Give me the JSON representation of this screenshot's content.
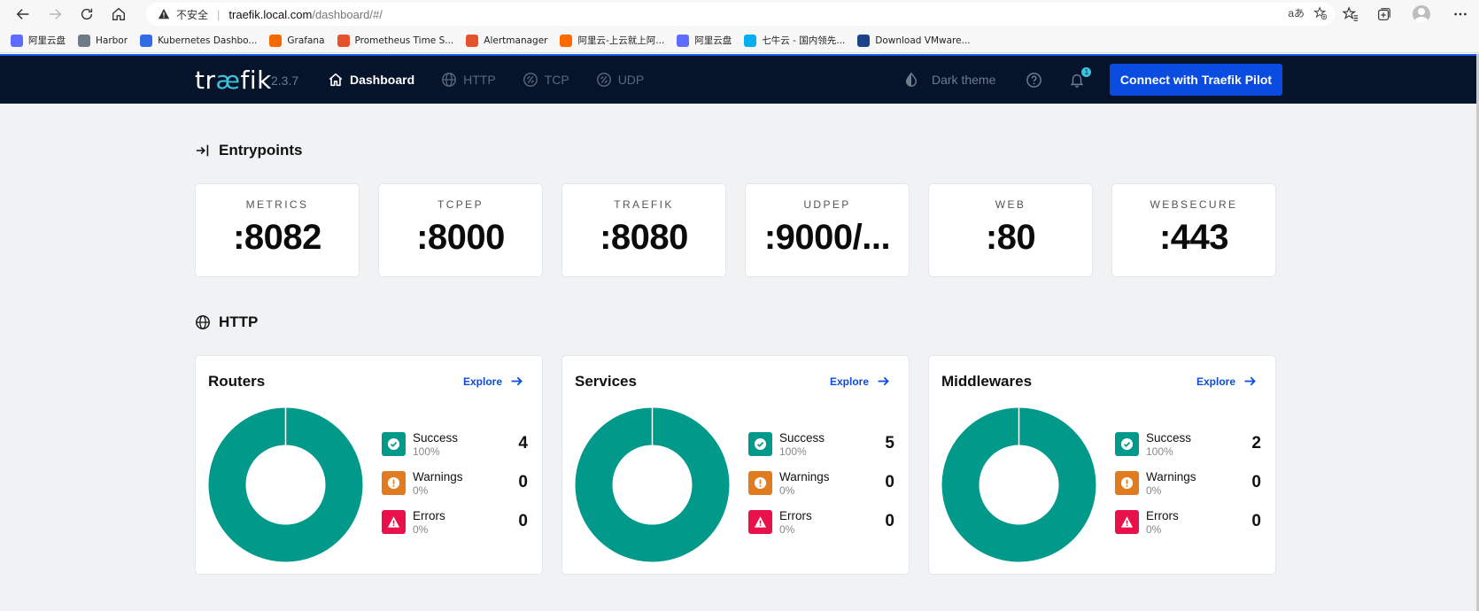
{
  "browser": {
    "insecure_label": "不安全",
    "url_host": "traefik.local.com",
    "url_path": "/dashboard/#/",
    "read_aloud": "aあ"
  },
  "bookmarks": [
    {
      "label": "阿里云盘",
      "icon": "aliyun-drive-icon",
      "color": "#5b6cff"
    },
    {
      "label": "Harbor",
      "icon": "harbor-icon",
      "color": "#6f7b86"
    },
    {
      "label": "Kubernetes Dashbo...",
      "icon": "kubernetes-icon",
      "color": "#326ce5"
    },
    {
      "label": "Grafana",
      "icon": "grafana-icon",
      "color": "#f46800"
    },
    {
      "label": "Prometheus Time S...",
      "icon": "prometheus-icon",
      "color": "#e6522c"
    },
    {
      "label": "Alertmanager",
      "icon": "alertmanager-icon",
      "color": "#e6522c"
    },
    {
      "label": "阿里云-上云就上阿...",
      "icon": "aliyun-icon",
      "color": "#ff6a00"
    },
    {
      "label": "阿里云盘",
      "icon": "aliyun-drive-icon",
      "color": "#5b6cff"
    },
    {
      "label": "七牛云 - 国内领先...",
      "icon": "qiniu-icon",
      "color": "#06aeef"
    },
    {
      "label": "Download VMware...",
      "icon": "vmware-icon",
      "color": "#1d428a"
    }
  ],
  "header": {
    "logo_pre": "tr",
    "logo_ae": "æ",
    "logo_post": "fik",
    "version": "2.3.7",
    "nav": [
      {
        "label": "Dashboard",
        "icon": "home-icon",
        "active": true
      },
      {
        "label": "HTTP",
        "icon": "globe-icon",
        "active": false
      },
      {
        "label": "TCP",
        "icon": "tcp-icon",
        "active": false
      },
      {
        "label": "UDP",
        "icon": "udp-icon",
        "active": false
      }
    ],
    "theme_label": "Dark theme",
    "notification_count": "1",
    "pilot_button": "Connect with Traefik Pilot"
  },
  "entrypoints": {
    "title": "Entrypoints",
    "items": [
      {
        "name": "METRICS",
        "port": ":8082"
      },
      {
        "name": "TCPEP",
        "port": ":8000"
      },
      {
        "name": "TRAEFIK",
        "port": ":8080"
      },
      {
        "name": "UDPEP",
        "port": ":9000/..."
      },
      {
        "name": "WEB",
        "port": ":80"
      },
      {
        "name": "WEBSECURE",
        "port": ":443"
      }
    ]
  },
  "http": {
    "title": "HTTP",
    "explore_label": "Explore",
    "cards": [
      {
        "title": "Routers",
        "success": {
          "label": "Success",
          "pct": "100%",
          "count": "4"
        },
        "warnings": {
          "label": "Warnings",
          "pct": "0%",
          "count": "0"
        },
        "errors": {
          "label": "Errors",
          "pct": "0%",
          "count": "0"
        }
      },
      {
        "title": "Services",
        "success": {
          "label": "Success",
          "pct": "100%",
          "count": "5"
        },
        "warnings": {
          "label": "Warnings",
          "pct": "0%",
          "count": "0"
        },
        "errors": {
          "label": "Errors",
          "pct": "0%",
          "count": "0"
        }
      },
      {
        "title": "Middlewares",
        "success": {
          "label": "Success",
          "pct": "100%",
          "count": "2"
        },
        "warnings": {
          "label": "Warnings",
          "pct": "0%",
          "count": "0"
        },
        "errors": {
          "label": "Errors",
          "pct": "0%",
          "count": "0"
        }
      }
    ]
  },
  "colors": {
    "success": "#00998a",
    "warning": "#e07b1f",
    "error": "#e8114a",
    "accent": "#0a4be0",
    "header_bg": "#06142b"
  }
}
